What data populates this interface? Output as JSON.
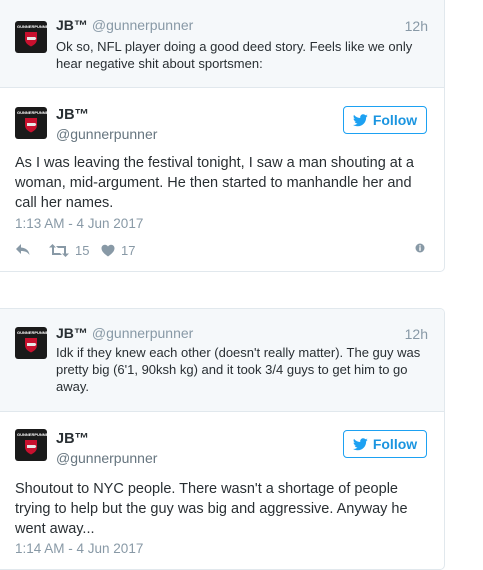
{
  "tweets": [
    {
      "context": {
        "name": "JB™",
        "handle": "@gunnerpunner",
        "time": "12h",
        "text": "Ok so, NFL player doing a good deed story. Feels like we only hear negative shit about sportsmen:"
      },
      "main": {
        "name": "JB™",
        "handle": "@gunnerpunner",
        "follow_label": "Follow",
        "text": "As I was leaving the festival tonight, I saw a man shouting at a woman, mid-argument. He then started to manhandle her and call her names.",
        "date": "1:13 AM - 4 Jun 2017",
        "retweets": "15",
        "likes": "17"
      }
    },
    {
      "context": {
        "name": "JB™",
        "handle": "@gunnerpunner",
        "time": "12h",
        "text": "Idk if they knew each other (doesn't really matter). The guy was pretty big (6'1, 90ksh kg) and it took 3/4 guys to get him to go away."
      },
      "main": {
        "name": "JB™",
        "handle": "@gunnerpunner",
        "follow_label": "Follow",
        "text": "Shoutout to NYC people. There wasn't a shortage of people trying to help but the guy was big and aggressive. Anyway he went away...",
        "date": "1:14 AM - 4 Jun 2017"
      }
    }
  ],
  "avatar_text": "GUNNERPUNNER",
  "icons": {
    "follow": "bird-icon",
    "reply": "reply-icon",
    "retweet": "retweet-icon",
    "like": "heart-icon",
    "info": "info-icon"
  },
  "colors": {
    "accent": "#1da1f2",
    "muted": "#8899a6",
    "context_bg": "#f5f8fa",
    "border": "#e1e8ed"
  }
}
